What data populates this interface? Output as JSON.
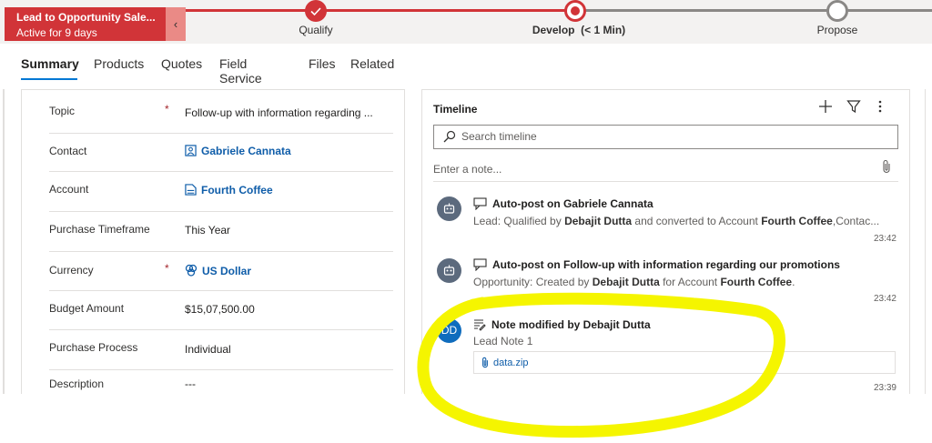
{
  "bpf": {
    "title": "Lead to Opportunity Sale...",
    "status": "Active for 9 days",
    "collapse_icon": "chevron-left-icon",
    "stages": [
      {
        "label": "Qualify",
        "state": "completed"
      },
      {
        "label": "Develop",
        "duration": "(< 1 Min)",
        "state": "active"
      },
      {
        "label": "Propose",
        "state": "pending"
      }
    ]
  },
  "tabs": [
    "Summary",
    "Products",
    "Quotes",
    "Field Service",
    "Files",
    "Related"
  ],
  "active_tab": "Summary",
  "form": {
    "fields": [
      {
        "label": "Topic",
        "required": "*",
        "value": "Follow-up with information regarding ..."
      },
      {
        "label": "Contact",
        "value": "Gabriele Cannata",
        "icon": "contact-icon"
      },
      {
        "label": "Account",
        "value": "Fourth Coffee",
        "icon": "account-icon"
      },
      {
        "label": "Purchase Timeframe",
        "value": "This Year"
      },
      {
        "label": "Currency",
        "required": "*",
        "value": "US Dollar",
        "icon": "currency-icon"
      },
      {
        "label": "Budget Amount",
        "value": "$15,07,500.00"
      },
      {
        "label": "Purchase Process",
        "value": "Individual"
      },
      {
        "label": "Description",
        "value": "---"
      }
    ]
  },
  "timeline": {
    "title": "Timeline",
    "search_placeholder": "Search timeline",
    "note_placeholder": "Enter a note...",
    "posts": [
      {
        "header": "Auto-post on Gabriele Cannata",
        "body_prefix": "Lead: Qualified by ",
        "body_b1": "Debajit Dutta",
        "body_mid": " and converted to Account ",
        "body_b2": "Fourth Coffee",
        "body_suffix": ",Contac...",
        "time": "23:42"
      },
      {
        "header": "Auto-post on Follow-up with information regarding our promotions",
        "body_prefix": "Opportunity: Created by ",
        "body_b1": "Debajit Dutta",
        "body_mid": " for Account ",
        "body_b2": "Fourth Coffee",
        "body_suffix": ".",
        "time": "23:42"
      },
      {
        "avatar": "DD",
        "header": "Note modified by Debajit Dutta",
        "body": "Lead Note 1",
        "attachment": "data.zip",
        "time": "23:39"
      }
    ]
  },
  "colors": {
    "accent": "#0078d4",
    "bpf_red": "#d13438",
    "link": "#0f5da9",
    "highlight": "#f5f500"
  }
}
